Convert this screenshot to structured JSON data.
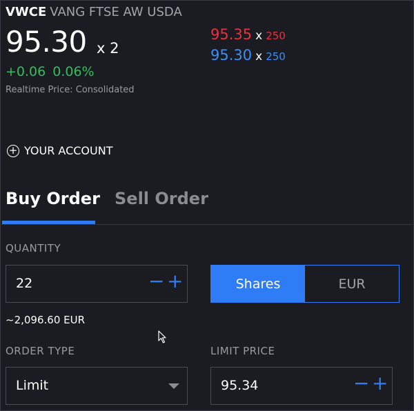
{
  "instrument": {
    "ticker": "VWCE",
    "name": "VANG FTSE AW USDA",
    "last_price": "95.30",
    "last_qty": "x 2",
    "change_abs": "+0.06",
    "change_pct": "0.06%",
    "price_source": "Realtime Price: Consolidated"
  },
  "quote": {
    "ask_price": "95.35",
    "ask_size": "250",
    "bid_price": "95.30",
    "bid_size": "250",
    "separator": "x"
  },
  "account": {
    "label": "YOUR ACCOUNT"
  },
  "tabs": [
    {
      "label": "Buy Order",
      "active": true
    },
    {
      "label": "Sell Order",
      "active": false
    }
  ],
  "order": {
    "quantity_label": "QUANTITY",
    "quantity_value": "22",
    "unit_options": [
      {
        "label": "Shares",
        "active": true
      },
      {
        "label": "EUR",
        "active": false
      }
    ],
    "approx_value": "~2,096.60 EUR",
    "order_type_label": "ORDER TYPE",
    "order_type_value": "Limit",
    "limit_price_label": "LIMIT PRICE",
    "limit_price_value": "95.34",
    "stepper_minus": "−",
    "stepper_plus": "+"
  },
  "colors": {
    "background": "#1b1b22",
    "accent": "#2e7cf6",
    "ask": "#e8323f",
    "gain": "#2fbf5b"
  },
  "icons": {
    "account": "plus-circle-icon",
    "order_type": "caret-down-icon",
    "pointer": "mouse-cursor-icon"
  }
}
